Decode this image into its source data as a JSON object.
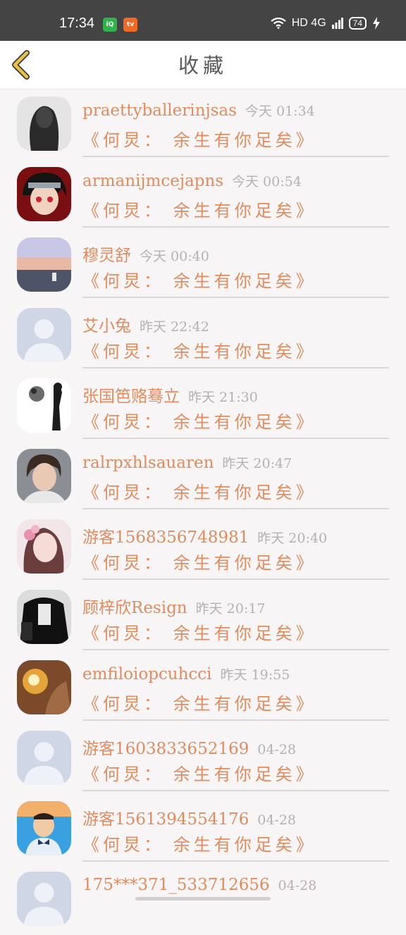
{
  "status_bar": {
    "time": "17:34",
    "app1": "iQ",
    "app2": "tv",
    "signal": "HD 4G",
    "battery": "74"
  },
  "header": {
    "title": "收藏"
  },
  "items": [
    {
      "name": "praettyballerinjsas",
      "time": "今天 01:34",
      "song": "《何炅： 余生有你足矣》",
      "avatar": "avatar-photo-dark"
    },
    {
      "name": "armanijmcejapns",
      "time": "今天 00:54",
      "song": "《何炅： 余生有你足矣》",
      "avatar": "avatar-anime-red"
    },
    {
      "name": "穆灵舒",
      "time": "今天 00:40",
      "song": "《何炅： 余生有你足矣》",
      "avatar": "avatar-sunset"
    },
    {
      "name": "艾小兔",
      "time": "昨天 22:42",
      "song": "《何炅： 余生有你足矣》",
      "avatar": "avatar-default"
    },
    {
      "name": "张国笆赂蓦立",
      "time": "昨天 21:30",
      "song": "《何炅： 余生有你足矣》",
      "avatar": "avatar-sketch"
    },
    {
      "name": "ralrpxhlsauaren",
      "time": "昨天 20:47",
      "song": "《何炅： 余生有你足矣》",
      "avatar": "avatar-boy"
    },
    {
      "name": "游客1568356748981",
      "time": "昨天 20:40",
      "song": "《何炅： 余生有你足矣》",
      "avatar": "avatar-girl-flowers"
    },
    {
      "name": "顾梓欣Resign",
      "time": "昨天 20:17",
      "song": "《何炅： 余生有你足矣》",
      "avatar": "avatar-black-hoodie"
    },
    {
      "name": "emfiloiopcuhcci",
      "time": "昨天 19:55",
      "song": "《何炅： 余生有你足矣》",
      "avatar": "avatar-fire"
    },
    {
      "name": "游客1603833652169",
      "time": "04-28",
      "song": "《何炅： 余生有你足矣》",
      "avatar": "avatar-default"
    },
    {
      "name": "游客1561394554176",
      "time": "04-28",
      "song": "《何炅： 余生有你足矣》",
      "avatar": "avatar-kid"
    },
    {
      "name": "175***371_533712656",
      "time": "04-28",
      "song": "",
      "avatar": "avatar-default"
    }
  ],
  "colors": {
    "accent": "#e38b5d",
    "status_bar": "#444444",
    "back_arrow": "#d9b23a"
  }
}
